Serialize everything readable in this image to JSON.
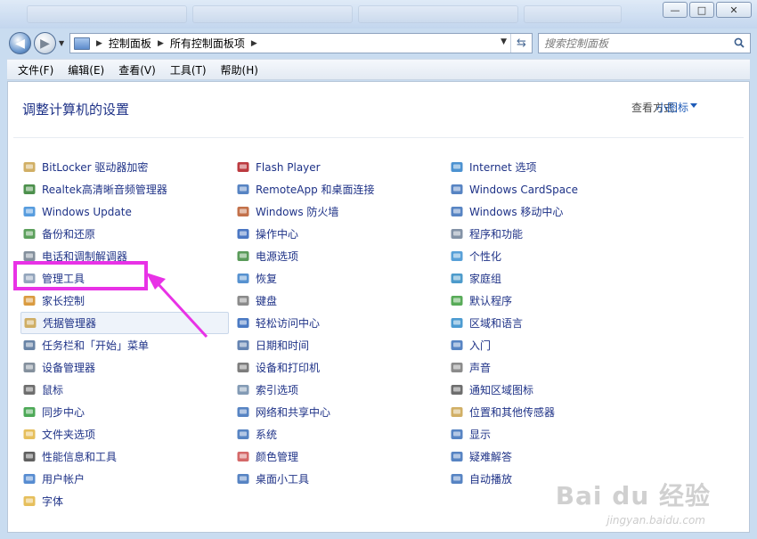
{
  "window": {
    "controls": {
      "minimize": "—",
      "maximize": "□",
      "close": "✕"
    }
  },
  "address": {
    "crumbs": [
      "控制面板",
      "所有控制面板项"
    ],
    "search_placeholder": "搜索控制面板"
  },
  "menubar": {
    "items": [
      "文件(F)",
      "编辑(E)",
      "查看(V)",
      "工具(T)",
      "帮助(H)"
    ]
  },
  "content": {
    "title": "调整计算机的设置",
    "view_by_label": "查看方式:",
    "view_by_value": "小图标"
  },
  "columns": [
    [
      {
        "label": "BitLocker 驱动器加密",
        "icon": "bitlocker-icon"
      },
      {
        "label": "Realtek高清晰音频管理器",
        "icon": "realtek-audio-icon"
      },
      {
        "label": "Windows Update",
        "icon": "windows-update-icon"
      },
      {
        "label": "备份和还原",
        "icon": "backup-icon"
      },
      {
        "label": "电话和调制解调器",
        "icon": "phone-modem-icon"
      },
      {
        "label": "管理工具",
        "icon": "admin-tools-icon"
      },
      {
        "label": "家长控制",
        "icon": "parental-controls-icon"
      },
      {
        "label": "凭据管理器",
        "icon": "credential-manager-icon"
      },
      {
        "label": "任务栏和「开始」菜单",
        "icon": "taskbar-icon"
      },
      {
        "label": "设备管理器",
        "icon": "device-manager-icon"
      },
      {
        "label": "鼠标",
        "icon": "mouse-icon"
      },
      {
        "label": "同步中心",
        "icon": "sync-center-icon"
      },
      {
        "label": "文件夹选项",
        "icon": "folder-options-icon"
      },
      {
        "label": "性能信息和工具",
        "icon": "performance-icon"
      },
      {
        "label": "用户帐户",
        "icon": "user-accounts-icon"
      },
      {
        "label": "字体",
        "icon": "fonts-icon"
      }
    ],
    [
      {
        "label": "Flash Player",
        "icon": "flash-player-icon"
      },
      {
        "label": "RemoteApp 和桌面连接",
        "icon": "remoteapp-icon"
      },
      {
        "label": "Windows 防火墙",
        "icon": "firewall-icon"
      },
      {
        "label": "操作中心",
        "icon": "action-center-icon"
      },
      {
        "label": "电源选项",
        "icon": "power-options-icon"
      },
      {
        "label": "恢复",
        "icon": "recovery-icon"
      },
      {
        "label": "键盘",
        "icon": "keyboard-icon"
      },
      {
        "label": "轻松访问中心",
        "icon": "ease-of-access-icon"
      },
      {
        "label": "日期和时间",
        "icon": "date-time-icon"
      },
      {
        "label": "设备和打印机",
        "icon": "devices-printers-icon"
      },
      {
        "label": "索引选项",
        "icon": "indexing-icon"
      },
      {
        "label": "网络和共享中心",
        "icon": "network-icon"
      },
      {
        "label": "系统",
        "icon": "system-icon"
      },
      {
        "label": "颜色管理",
        "icon": "color-management-icon"
      },
      {
        "label": "桌面小工具",
        "icon": "desktop-gadgets-icon"
      }
    ],
    [
      {
        "label": "Internet 选项",
        "icon": "internet-options-icon"
      },
      {
        "label": "Windows CardSpace",
        "icon": "cardspace-icon"
      },
      {
        "label": "Windows 移动中心",
        "icon": "mobility-center-icon"
      },
      {
        "label": "程序和功能",
        "icon": "programs-icon"
      },
      {
        "label": "个性化",
        "icon": "personalization-icon"
      },
      {
        "label": "家庭组",
        "icon": "homegroup-icon"
      },
      {
        "label": "默认程序",
        "icon": "default-programs-icon"
      },
      {
        "label": "区域和语言",
        "icon": "region-language-icon"
      },
      {
        "label": "入门",
        "icon": "getting-started-icon"
      },
      {
        "label": "声音",
        "icon": "sound-icon"
      },
      {
        "label": "通知区域图标",
        "icon": "notification-icons-icon"
      },
      {
        "label": "位置和其他传感器",
        "icon": "location-sensors-icon"
      },
      {
        "label": "显示",
        "icon": "display-icon"
      },
      {
        "label": "疑难解答",
        "icon": "troubleshooting-icon"
      },
      {
        "label": "自动播放",
        "icon": "autoplay-icon"
      }
    ]
  ],
  "highlight_color": "#e832e6",
  "watermark": {
    "text": "Bai du 经验",
    "sub": "jingyan.baidu.com"
  }
}
